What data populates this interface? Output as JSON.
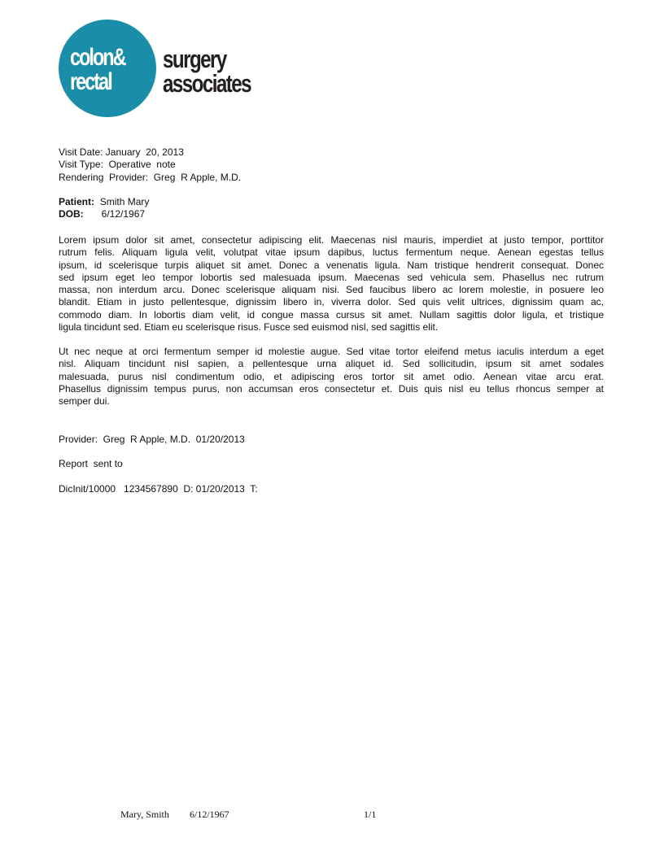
{
  "brand_color": "#1a8ea8",
  "logo": {
    "circle_line1": "colon&",
    "circle_line2": "rectal",
    "side_line1": "surgery",
    "side_line2": "associates"
  },
  "visit": {
    "date": "Visit Date: January  20, 2013",
    "type": "Visit Type:  Operative  note",
    "provider": "Rendering  Provider:  Greg  R Apple, M.D."
  },
  "patient": {
    "label": "Patient:",
    "name": "Smith Mary",
    "dob_label": "DOB:",
    "dob": "6/12/1967"
  },
  "paragraph1": [
    "Lorem ipsum dolor sit amet, consectetur adipiscing elit. Maecenas nisl mauris, imperdiet at justo tempor, porttitor",
    "rutrum felis. Aliquam ligula velit, volutpat vitae ipsum dapibus, luctus fermentum neque. Aenean egestas tellus",
    "ipsum, id scelerisque turpis aliquet sit amet. Donec a venenatis ligula. Nam tristique hendrerit consequat. Donec",
    "sed ipsum eget leo tempor lobortis sed malesuada ipsum. Maecenas sed vehicula sem. Phasellus nec rutrum",
    "massa, non interdum arcu. Donec scelerisque aliquam nisi. Sed faucibus libero ac lorem molestie, in posuere leo",
    "blandit. Etiam in justo pellentesque, dignissim libero in, viverra dolor. Sed quis velit ultrices, dignissim quam ac,",
    "commodo diam. In lobortis diam velit, id congue massa cursus sit amet. Nullam sagittis dolor ligula, et tristique",
    "ligula tincidunt sed. Etiam eu scelerisque risus. Fusce sed euismod nisl, sed sagittis elit."
  ],
  "paragraph2": [
    "Ut nec neque at orci fermentum semper id molestie augue. Sed vitae tortor eleifend metus iaculis interdum a eget",
    "nisl. Aliquam tincidunt nisl sapien, a pellentesque urna aliquet id. Sed sollicitudin, ipsum sit amet sodales",
    "malesuada, purus nisl condimentum odio, et adipiscing eros tortor sit amet odio. Aenean vitae arcu erat.",
    "Phasellus dignissim tempus purus, non accumsan eros consectetur et. Duis quis nisl eu tellus rhoncus semper at",
    "semper dui."
  ],
  "signature": {
    "provider": "Provider:  Greg  R Apple, M.D.  01/20/2013",
    "report": "Report  sent to",
    "dictation": "DicInit/10000   1234567890  D: 01/20/2013  T:"
  },
  "footer": {
    "name": "Mary, Smith",
    "dob": "6/12/1967",
    "page": "1/1"
  }
}
